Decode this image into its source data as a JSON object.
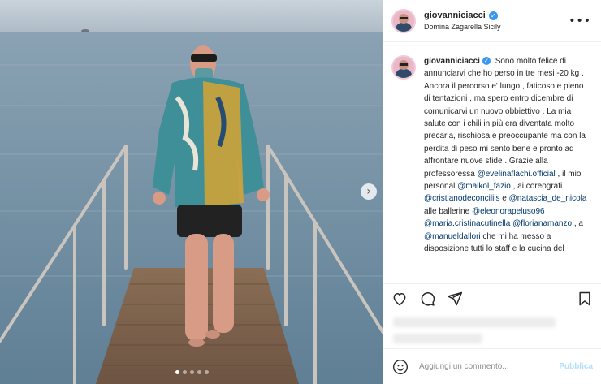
{
  "header": {
    "username": "giovanniciacci",
    "location": "Domina Zagarella Sicily",
    "more_label": "•••"
  },
  "caption": {
    "username": "giovanniciacci",
    "segments": [
      {
        "text": "Sono molto felice di annunciarvi che ho perso in tre mesi -20 kg . Ancora il percorso e' lungo , faticoso e pieno di tentazioni , ma spero entro dicembre di comunicarvi un nuovo obbiettivo . La mia salute con i chili in più era diventata molto precaria, rischiosa e preoccupante ma con la perdita di peso mi sento bene e pronto ad affrontare nuove sfide . Grazie alla professoressa ",
        "mention": false
      },
      {
        "text": "@evelinaflachi.official",
        "mention": true
      },
      {
        "text": " , il mio personal ",
        "mention": false
      },
      {
        "text": "@maikol_fazio",
        "mention": true
      },
      {
        "text": " , ai coreografi ",
        "mention": false
      },
      {
        "text": "@cristianodeconciliis",
        "mention": true
      },
      {
        "text": " e ",
        "mention": false
      },
      {
        "text": "@natascia_de_nicola",
        "mention": true
      },
      {
        "text": " , alle ballerine ",
        "mention": false
      },
      {
        "text": "@eleonorapeluso96",
        "mention": true
      },
      {
        "text": " ",
        "mention": false
      },
      {
        "text": "@maria.cristinacutinella",
        "mention": true
      },
      {
        "text": " ",
        "mention": false
      },
      {
        "text": "@florianamanzo",
        "mention": true
      },
      {
        "text": " , a ",
        "mention": false
      },
      {
        "text": "@manueldallori",
        "mention": true
      },
      {
        "text": " che mi ha messo a disposizione tutti lo staff e la cucina del",
        "mention": false
      }
    ]
  },
  "icons": {
    "like": "heart-icon",
    "comment": "comment-icon",
    "share": "paper-plane-icon",
    "save": "bookmark-icon",
    "emoji": "smiley-icon",
    "next": "chevron-right-icon",
    "verified": "verified-badge-icon"
  },
  "carousel": {
    "next_label": "›",
    "slide_count": 5,
    "active_slide": 1
  },
  "comment": {
    "placeholder": "Aggiungi un commento...",
    "publish_label": "Pubblica"
  },
  "colors": {
    "link": "#00376b",
    "verified": "#3897f0",
    "publish_disabled": "#b2dffc"
  }
}
